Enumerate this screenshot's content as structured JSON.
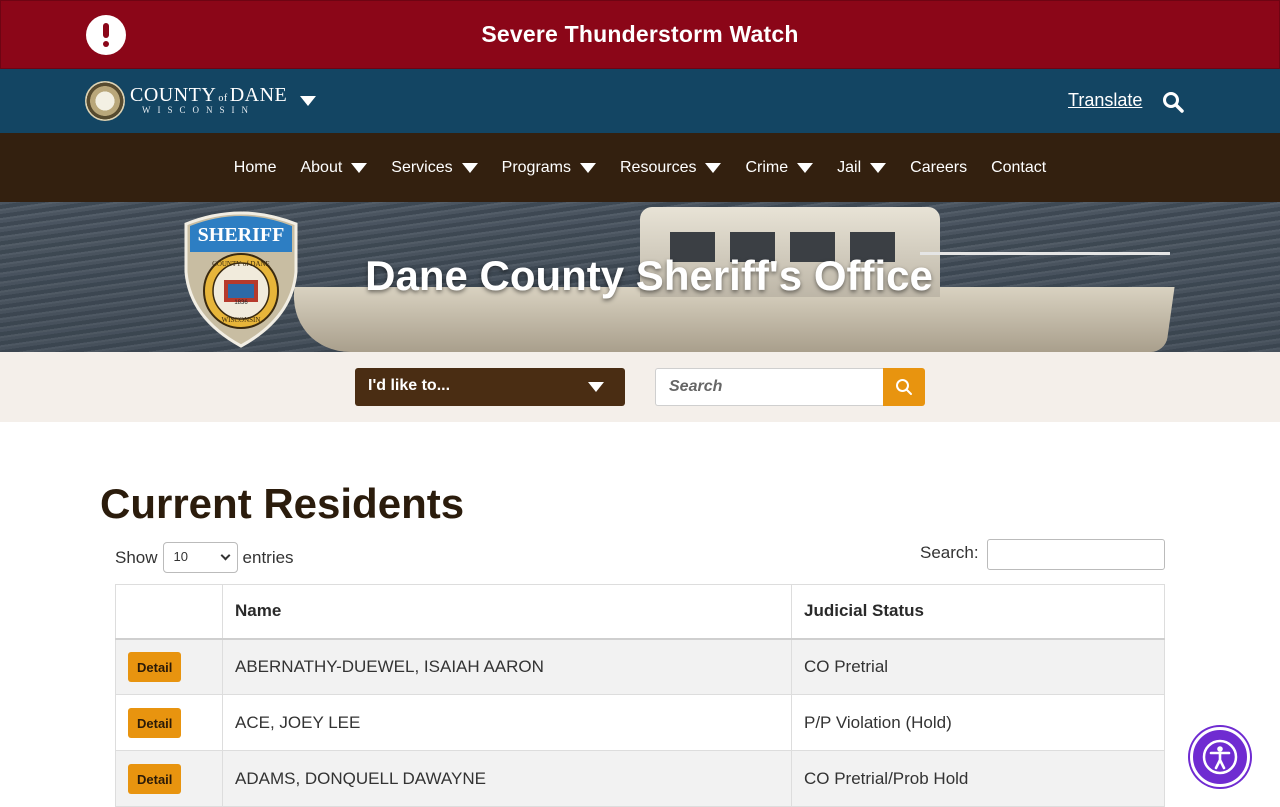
{
  "alert": {
    "text": "Severe Thunderstorm Watch"
  },
  "county_bar": {
    "name_left": "COUNTY",
    "name_of": "of",
    "name_right": "DANE",
    "sub": "WISCONSIN",
    "translate": "Translate"
  },
  "nav": [
    {
      "label": "Home",
      "has_menu": false
    },
    {
      "label": "About",
      "has_menu": true
    },
    {
      "label": "Services",
      "has_menu": true
    },
    {
      "label": "Programs",
      "has_menu": true
    },
    {
      "label": "Resources",
      "has_menu": true
    },
    {
      "label": "Crime",
      "has_menu": true
    },
    {
      "label": "Jail",
      "has_menu": true
    },
    {
      "label": "Careers",
      "has_menu": false
    },
    {
      "label": "Contact",
      "has_menu": false
    }
  ],
  "hero": {
    "title": "Dane County Sheriff's Office",
    "badge_top": "SHERIFF",
    "badge_ring_top": "COUNTY of DANE",
    "badge_ring_bottom": "WISCONSIN",
    "badge_year": "1836"
  },
  "actions": {
    "ilike": "I'd like to...",
    "search_placeholder": "Search"
  },
  "content": {
    "title": "Current Residents",
    "show_prefix": "Show",
    "show_value": "10",
    "show_suffix": "entries",
    "search_label": "Search:"
  },
  "table": {
    "headers": [
      "",
      "Name",
      "Judicial Status"
    ],
    "detail_label": "Detail",
    "rows": [
      {
        "name": "ABERNATHY-DUEWEL, ISAIAH AARON",
        "status": "CO Pretrial"
      },
      {
        "name": "ACE, JOEY LEE",
        "status": "P/P Violation (Hold)"
      },
      {
        "name": "ADAMS, DONQUELL DAWAYNE",
        "status": "CO Pretrial/Prob Hold"
      }
    ]
  },
  "colors": {
    "alert_red": "#8b0618",
    "county_blue": "#134563",
    "nav_brown": "#33200f",
    "accent_orange": "#e8940f",
    "a11y_purple": "#6f2bd1"
  },
  "icons": [
    "alert-icon",
    "chevron-down-icon",
    "search-icon",
    "accessibility-icon"
  ]
}
